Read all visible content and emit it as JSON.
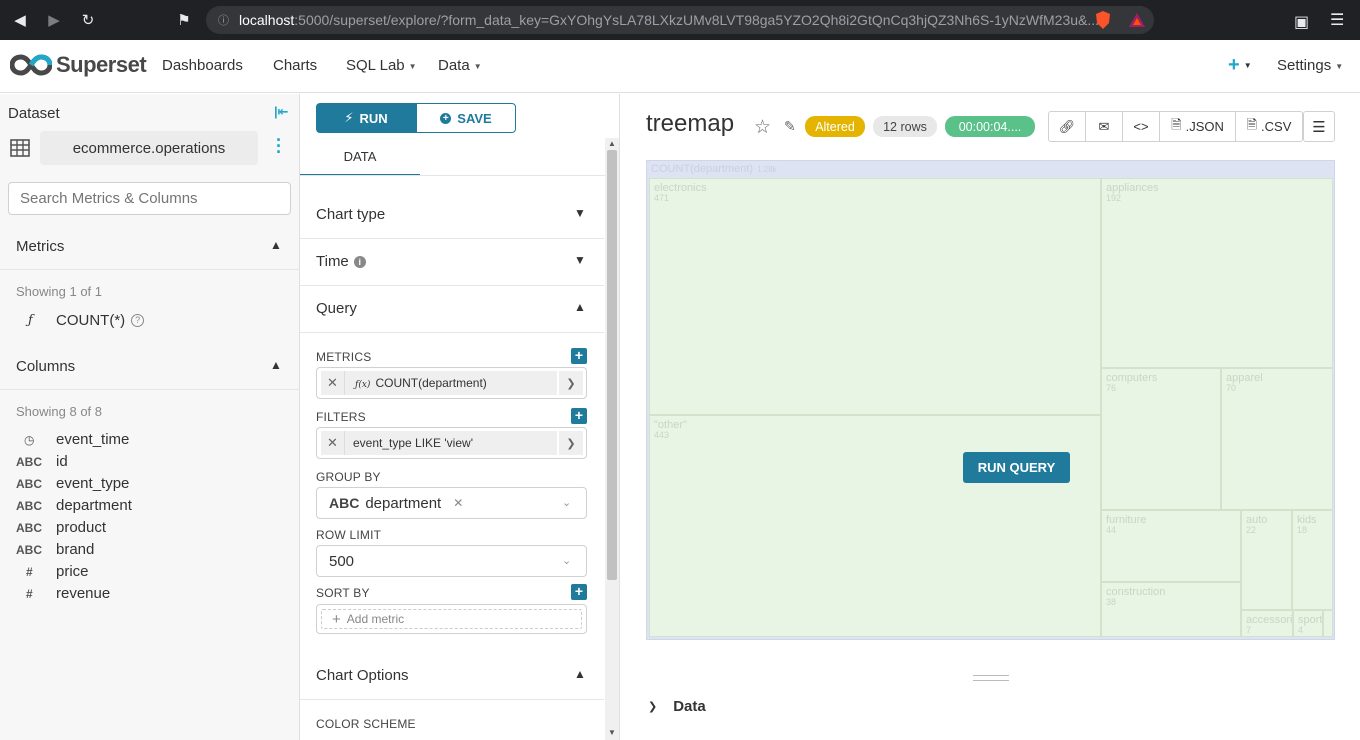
{
  "browser": {
    "url_host": "localhost",
    "url_rest": ":5000/superset/explore/?form_data_key=GxYOhgYsLA78LXkzUMv8LVT98ga5YZO2Qh8i2GtQnCq3hjQZ3Nh6S-1yNzWfM23u&..."
  },
  "nav": {
    "brand": "Superset",
    "dashboards": "Dashboards",
    "charts": "Charts",
    "sqllab": "SQL Lab",
    "data": "Data",
    "plus": "+",
    "settings": "Settings"
  },
  "dataset_panel": {
    "title": "Dataset",
    "dataset_name": "ecommerce.operations",
    "search_placeholder": "Search Metrics & Columns",
    "metrics_header": "Metrics",
    "metrics_showing": "Showing 1 of 1",
    "metrics": [
      {
        "type": "ƒ",
        "name": "COUNT(*)"
      }
    ],
    "columns_header": "Columns",
    "columns_showing": "Showing 8 of 8",
    "columns": [
      {
        "type": "clock",
        "name": "event_time"
      },
      {
        "type": "ABC",
        "name": "id"
      },
      {
        "type": "ABC",
        "name": "event_type"
      },
      {
        "type": "ABC",
        "name": "department"
      },
      {
        "type": "ABC",
        "name": "product"
      },
      {
        "type": "ABC",
        "name": "brand"
      },
      {
        "type": "#",
        "name": "price"
      },
      {
        "type": "#",
        "name": "revenue"
      }
    ]
  },
  "control_panel": {
    "run": "RUN",
    "save": "SAVE",
    "data_tab": "DATA",
    "sections": {
      "chart_type": "Chart type",
      "time": "Time",
      "query": "Query",
      "chart_options": "Chart Options"
    },
    "metrics_label": "METRICS",
    "metric_value": "COUNT(department)",
    "metric_fx": "ƒ(x)",
    "filters_label": "FILTERS",
    "filter_value": "event_type LIKE 'view'",
    "groupby_label": "GROUP BY",
    "groupby_type": "ABC",
    "groupby_value": "department",
    "row_limit_label": "ROW LIMIT",
    "row_limit_value": "500",
    "sort_by_label": "SORT BY",
    "add_metric_placeholder": "Add metric",
    "color_scheme_label": "COLOR SCHEME"
  },
  "chart": {
    "title": "treemap",
    "altered": "Altered",
    "rows": "12 rows",
    "timer": "00:00:04....",
    "json": ".JSON",
    "csv": ".CSV",
    "run_query": "RUN QUERY",
    "data_section": "Data",
    "root_label": "COUNT(department)",
    "root_value": "1.28k",
    "cells": [
      {
        "name": "electronics",
        "value": "471"
      },
      {
        "name": "appliances",
        "value": "192"
      },
      {
        "name": "computers",
        "value": "76"
      },
      {
        "name": "apparel",
        "value": "70"
      },
      {
        "name": "\"other\"",
        "value": "443"
      },
      {
        "name": "furniture",
        "value": "44"
      },
      {
        "name": "auto",
        "value": "22"
      },
      {
        "name": "kids",
        "value": "18"
      },
      {
        "name": "construction",
        "value": "38"
      },
      {
        "name": "accessories",
        "value": "7"
      },
      {
        "name": "sport",
        "value": "4"
      }
    ]
  },
  "colors": {
    "primary": "#1f7a9c",
    "accent": "#20a7c9",
    "altered": "#e5b400",
    "success": "#5ac189"
  }
}
